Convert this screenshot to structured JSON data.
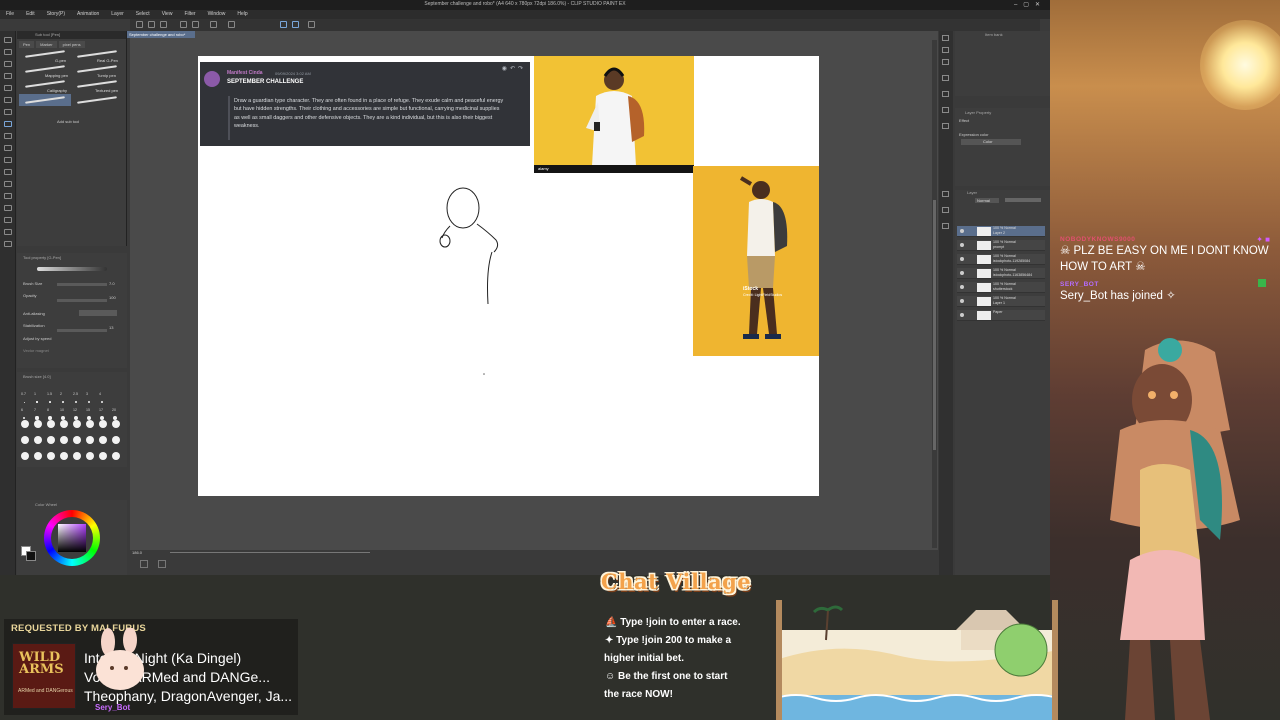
{
  "app": {
    "window_title": "September challenge and robo* (A4 640 x 780px 72dpi 186.0%) - CLIP STUDIO PAINT EX",
    "menu": [
      "File",
      "Edit",
      "Story(P)",
      "Animation",
      "Layer",
      "Select",
      "View",
      "Filter",
      "Window",
      "Help"
    ],
    "canvas_tab": "September challenge and robo*",
    "subtool": {
      "header": "Sub tool [Pen]",
      "tabs": [
        "Pen",
        "Marker",
        "pixel pens"
      ],
      "brushes": [
        "G-pen",
        "Real G-Pen",
        "Mapping pen",
        "Turnip pen",
        "Calligraphy",
        "Textured pen",
        "",
        ""
      ],
      "add_label": "Add sub tool"
    },
    "tool_property": {
      "header": "Tool property [G-Pen]",
      "rows": [
        "Brush Size",
        "Opacity",
        "Anti-aliasing",
        "Stabilization",
        "Adjust by speed",
        "Vector magnet"
      ],
      "values": [
        "7.0",
        "100",
        "",
        "13"
      ]
    },
    "brush_size": {
      "header": "Brush size [4.0]",
      "sizes_row1": [
        "0.7",
        "1",
        "1.5",
        "2",
        "2.5",
        "3",
        "4"
      ],
      "sizes_row2": [
        "6",
        "7",
        "8",
        "10",
        "12",
        "15",
        "17",
        "20"
      ]
    },
    "color_wheel_header": "Color Wheel",
    "navigator_header": "Navigator",
    "item_bank_header": "Item bank",
    "layer_property": {
      "header": "Layer Property",
      "effect": "Effect",
      "expression": "Expression color",
      "expression_value": "Color"
    },
    "layers": {
      "header": "Layer",
      "blend": "Normal",
      "opacity": "100",
      "items": [
        {
          "name": "100 % Normal\nLayer 2",
          "selected": true
        },
        {
          "name": "100 % Normal\nprompt",
          "selected": false
        },
        {
          "name": "100 % Normal\nistockphoto-119285084",
          "selected": false
        },
        {
          "name": "100 % Normal\nistockphoto-1163856484",
          "selected": false
        },
        {
          "name": "100 % Normal\nshutterstock",
          "selected": false
        },
        {
          "name": "100 % Normal\nLayer 1",
          "selected": false
        },
        {
          "name": "Paper",
          "selected": false
        }
      ]
    },
    "zoom": "186.0"
  },
  "discord": {
    "username": "Manifest Cinda",
    "date": "09/09/2024 3:02 AM",
    "heading": "SEPTEMBER CHALLENGE",
    "body": "Draw a guardian type character. They are often found in a place of refuge. They exude calm and peaceful energy but have hidden strengths. Their clothing and accessories are simple but functional, carrying medicinal supplies as well as small daggers and other defensive objects. They are a kind individual, but this is also their biggest weakness."
  },
  "photos": {
    "photo1_caption": "alamy",
    "photo2_istock": "iStock",
    "photo2_credit": "Credit: LightFieldStudios"
  },
  "chat": {
    "messages": [
      {
        "user": "NOBODYKNOWS9000",
        "user_color": "#e0506e",
        "text": "PLZ BE EASY ON ME I DONT KNOW HOW TO ART"
      },
      {
        "user": "SERY_BOT",
        "user_color": "#b46cff",
        "text": "Sery_Bot has joined"
      }
    ]
  },
  "song": {
    "requested_by": "REQUESTED BY MALFURUS",
    "line1": "Into the Night (Ka Dingel)",
    "line2": "Vocals: ARMed and DANGe...",
    "line3": "Theophany, DragonAvenger, Ja...",
    "album_title": "WILD ARMS",
    "album_sub": "ARMed and DANGerous",
    "bot_name": "Sery_Bot"
  },
  "chat_village": {
    "logo": "Chat Village",
    "lines": [
      "Type !join to enter a race.",
      "Type !join 200 to make a",
      "higher initial bet.",
      "Be the first one to start",
      "the race NOW!"
    ]
  },
  "colors": {
    "accent_layer": "#5a6e8c",
    "requested": "#e8d59a",
    "chat_village": "#f3a24b"
  }
}
